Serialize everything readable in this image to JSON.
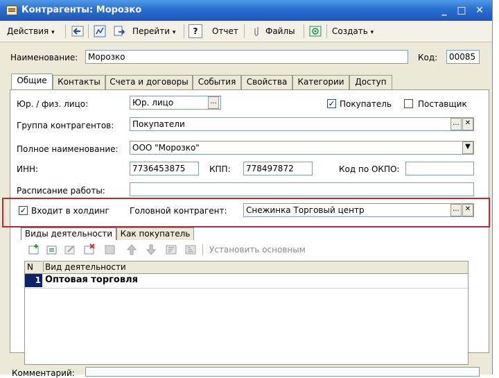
{
  "window": {
    "title": "Контрагенты: Морозко"
  },
  "window_controls": {
    "minimize": "_",
    "maximize": "□",
    "close": "✕"
  },
  "toolbar": {
    "actions": "Действия",
    "goto": "Перейти",
    "help": "?",
    "report": "Отчет",
    "files": "Файлы",
    "create": "Создать",
    "dropdown_glyph": "▾"
  },
  "header": {
    "name_label": "Наименование:",
    "name_value": "Морозко",
    "code_label": "Код:",
    "code_value": "00085"
  },
  "tabs": [
    "Общие",
    "Контакты",
    "Счета и договоры",
    "События",
    "Свойства",
    "Категории",
    "Доступ"
  ],
  "general": {
    "entity_type_label": "Юр. / физ. лицо:",
    "entity_type_value": "Юр. лицо",
    "buyer_label": "Покупатель",
    "buyer_checked": true,
    "supplier_label": "Поставщик",
    "supplier_checked": false,
    "group_label": "Группа контрагентов:",
    "group_value": "Покупатели",
    "full_name_label": "Полное наименование:",
    "full_name_value": "ООО \"Морозко\"",
    "inn_label": "ИНН:",
    "inn_value": "7736453875",
    "kpp_label": "КПП:",
    "kpp_value": "778497872",
    "okpo_label": "Код по ОКПО:",
    "okpo_value": "",
    "schedule_label": "Расписание работы:",
    "schedule_value": "",
    "holding_label": "Входит в холдинг",
    "holding_checked": true,
    "parent_label": "Головной контрагент:",
    "parent_value": "Снежинка Торговый центр"
  },
  "inner_tabs": [
    "Виды деятельности",
    "Как покупатель"
  ],
  "activities_toolbar": {
    "set_main": "Установить основным"
  },
  "activities_table": {
    "columns": [
      "N",
      "Вид деятельности"
    ],
    "rows": [
      {
        "n": "1",
        "name": "Оптовая торговля"
      }
    ]
  },
  "footer": {
    "comment_label": "Комментарий:"
  },
  "colors": {
    "title_bar": "#2a6fd0",
    "highlight_box": "#c0262e",
    "row_number_bg": "#0a246a"
  }
}
